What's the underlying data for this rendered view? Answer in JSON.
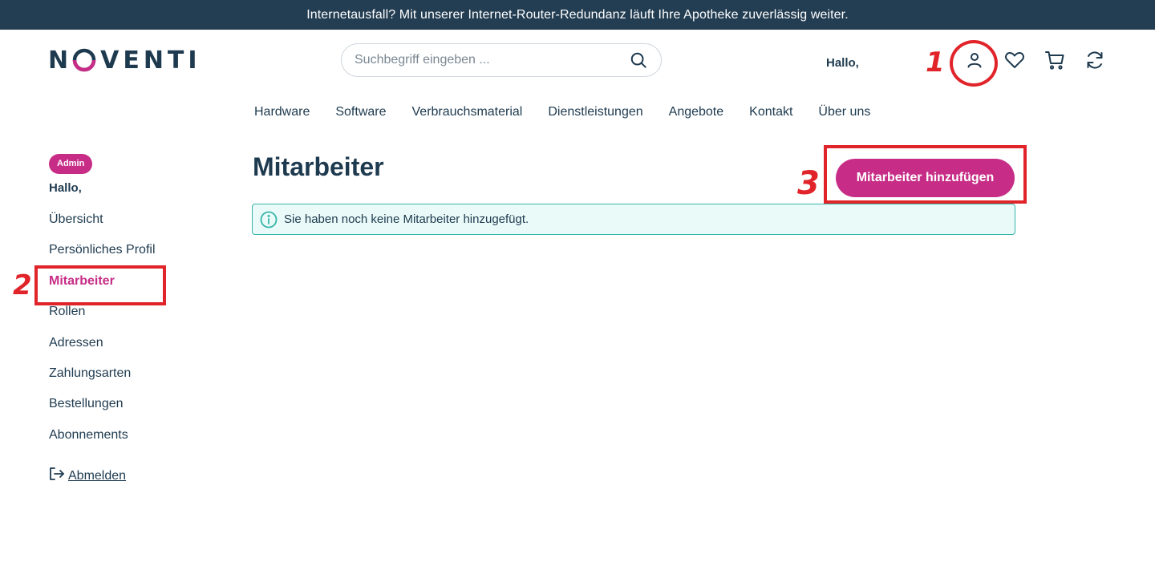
{
  "announcement": "Internetausfall? Mit unserer Internet-Router-Redundanz läuft Ihre Apotheke zuverlässig weiter.",
  "brand": {
    "logo_text_before": "N",
    "logo_text_after": "VENTI",
    "accent_color": "#c72d86",
    "dark_color": "#1e3a4f"
  },
  "search": {
    "placeholder": "Suchbegriff eingeben ..."
  },
  "header": {
    "greeting": "Hallo,",
    "icons": [
      "account-icon",
      "wishlist-heart-icon",
      "cart-icon",
      "refresh-icon"
    ]
  },
  "nav": [
    "Hardware",
    "Software",
    "Verbrauchsmaterial",
    "Dienstleistungen",
    "Angebote",
    "Kontakt",
    "Über uns"
  ],
  "sidebar": {
    "badge": "Admin",
    "greeting": "Hallo,",
    "items": [
      {
        "label": "Übersicht"
      },
      {
        "label": "Persönliches Profil"
      },
      {
        "label": "Mitarbeiter",
        "active": true
      },
      {
        "label": "Rollen"
      },
      {
        "label": "Adressen"
      },
      {
        "label": "Zahlungsarten"
      },
      {
        "label": "Bestellungen"
      },
      {
        "label": "Abonnements"
      }
    ],
    "logout": "Abmelden"
  },
  "main": {
    "title": "Mitarbeiter",
    "add_button": "Mitarbeiter hinzufügen",
    "info_message": "Sie haben noch keine Mitarbeiter hinzugefügt."
  },
  "annotations": {
    "step1": "1",
    "step2": "2",
    "step3": "3",
    "color": "#e0242a"
  }
}
